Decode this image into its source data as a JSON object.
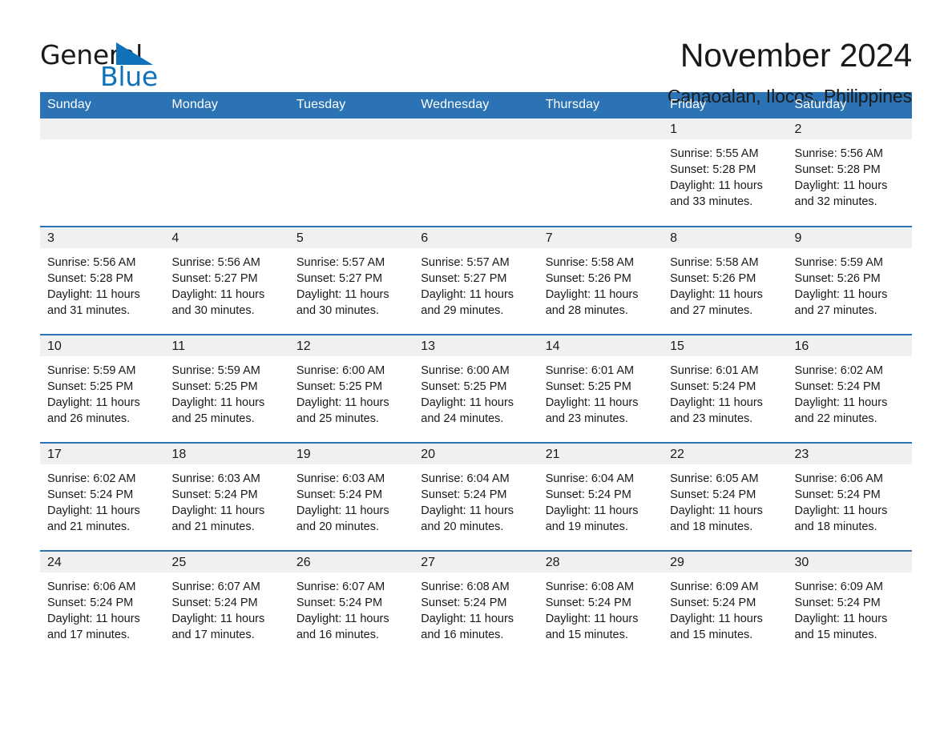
{
  "brand": {
    "name_part1": "General",
    "name_part2": "Blue",
    "triangle_icon": "triangle-icon",
    "accent_color": "#1172bc"
  },
  "header": {
    "month_title": "November 2024",
    "location": "Canaoalan, Ilocos, Philippines",
    "header_bg_color": "#2b73b5",
    "daynum_band_color": "#f0f0f0"
  },
  "weekday_headers": [
    "Sunday",
    "Monday",
    "Tuesday",
    "Wednesday",
    "Thursday",
    "Friday",
    "Saturday"
  ],
  "labels": {
    "sunrise_prefix": "Sunrise:",
    "sunset_prefix": "Sunset:",
    "daylight_prefix": "Daylight:"
  },
  "weeks": [
    [
      {
        "day": "",
        "empty": true
      },
      {
        "day": "",
        "empty": true
      },
      {
        "day": "",
        "empty": true
      },
      {
        "day": "",
        "empty": true
      },
      {
        "day": "",
        "empty": true
      },
      {
        "day": "1",
        "sunrise": "Sunrise: 5:55 AM",
        "sunset": "Sunset: 5:28 PM",
        "daylight_line1": "Daylight: 11 hours",
        "daylight_line2": "and 33 minutes."
      },
      {
        "day": "2",
        "sunrise": "Sunrise: 5:56 AM",
        "sunset": "Sunset: 5:28 PM",
        "daylight_line1": "Daylight: 11 hours",
        "daylight_line2": "and 32 minutes."
      }
    ],
    [
      {
        "day": "3",
        "sunrise": "Sunrise: 5:56 AM",
        "sunset": "Sunset: 5:28 PM",
        "daylight_line1": "Daylight: 11 hours",
        "daylight_line2": "and 31 minutes."
      },
      {
        "day": "4",
        "sunrise": "Sunrise: 5:56 AM",
        "sunset": "Sunset: 5:27 PM",
        "daylight_line1": "Daylight: 11 hours",
        "daylight_line2": "and 30 minutes."
      },
      {
        "day": "5",
        "sunrise": "Sunrise: 5:57 AM",
        "sunset": "Sunset: 5:27 PM",
        "daylight_line1": "Daylight: 11 hours",
        "daylight_line2": "and 30 minutes."
      },
      {
        "day": "6",
        "sunrise": "Sunrise: 5:57 AM",
        "sunset": "Sunset: 5:27 PM",
        "daylight_line1": "Daylight: 11 hours",
        "daylight_line2": "and 29 minutes."
      },
      {
        "day": "7",
        "sunrise": "Sunrise: 5:58 AM",
        "sunset": "Sunset: 5:26 PM",
        "daylight_line1": "Daylight: 11 hours",
        "daylight_line2": "and 28 minutes."
      },
      {
        "day": "8",
        "sunrise": "Sunrise: 5:58 AM",
        "sunset": "Sunset: 5:26 PM",
        "daylight_line1": "Daylight: 11 hours",
        "daylight_line2": "and 27 minutes."
      },
      {
        "day": "9",
        "sunrise": "Sunrise: 5:59 AM",
        "sunset": "Sunset: 5:26 PM",
        "daylight_line1": "Daylight: 11 hours",
        "daylight_line2": "and 27 minutes."
      }
    ],
    [
      {
        "day": "10",
        "sunrise": "Sunrise: 5:59 AM",
        "sunset": "Sunset: 5:25 PM",
        "daylight_line1": "Daylight: 11 hours",
        "daylight_line2": "and 26 minutes."
      },
      {
        "day": "11",
        "sunrise": "Sunrise: 5:59 AM",
        "sunset": "Sunset: 5:25 PM",
        "daylight_line1": "Daylight: 11 hours",
        "daylight_line2": "and 25 minutes."
      },
      {
        "day": "12",
        "sunrise": "Sunrise: 6:00 AM",
        "sunset": "Sunset: 5:25 PM",
        "daylight_line1": "Daylight: 11 hours",
        "daylight_line2": "and 25 minutes."
      },
      {
        "day": "13",
        "sunrise": "Sunrise: 6:00 AM",
        "sunset": "Sunset: 5:25 PM",
        "daylight_line1": "Daylight: 11 hours",
        "daylight_line2": "and 24 minutes."
      },
      {
        "day": "14",
        "sunrise": "Sunrise: 6:01 AM",
        "sunset": "Sunset: 5:25 PM",
        "daylight_line1": "Daylight: 11 hours",
        "daylight_line2": "and 23 minutes."
      },
      {
        "day": "15",
        "sunrise": "Sunrise: 6:01 AM",
        "sunset": "Sunset: 5:24 PM",
        "daylight_line1": "Daylight: 11 hours",
        "daylight_line2": "and 23 minutes."
      },
      {
        "day": "16",
        "sunrise": "Sunrise: 6:02 AM",
        "sunset": "Sunset: 5:24 PM",
        "daylight_line1": "Daylight: 11 hours",
        "daylight_line2": "and 22 minutes."
      }
    ],
    [
      {
        "day": "17",
        "sunrise": "Sunrise: 6:02 AM",
        "sunset": "Sunset: 5:24 PM",
        "daylight_line1": "Daylight: 11 hours",
        "daylight_line2": "and 21 minutes."
      },
      {
        "day": "18",
        "sunrise": "Sunrise: 6:03 AM",
        "sunset": "Sunset: 5:24 PM",
        "daylight_line1": "Daylight: 11 hours",
        "daylight_line2": "and 21 minutes."
      },
      {
        "day": "19",
        "sunrise": "Sunrise: 6:03 AM",
        "sunset": "Sunset: 5:24 PM",
        "daylight_line1": "Daylight: 11 hours",
        "daylight_line2": "and 20 minutes."
      },
      {
        "day": "20",
        "sunrise": "Sunrise: 6:04 AM",
        "sunset": "Sunset: 5:24 PM",
        "daylight_line1": "Daylight: 11 hours",
        "daylight_line2": "and 20 minutes."
      },
      {
        "day": "21",
        "sunrise": "Sunrise: 6:04 AM",
        "sunset": "Sunset: 5:24 PM",
        "daylight_line1": "Daylight: 11 hours",
        "daylight_line2": "and 19 minutes."
      },
      {
        "day": "22",
        "sunrise": "Sunrise: 6:05 AM",
        "sunset": "Sunset: 5:24 PM",
        "daylight_line1": "Daylight: 11 hours",
        "daylight_line2": "and 18 minutes."
      },
      {
        "day": "23",
        "sunrise": "Sunrise: 6:06 AM",
        "sunset": "Sunset: 5:24 PM",
        "daylight_line1": "Daylight: 11 hours",
        "daylight_line2": "and 18 minutes."
      }
    ],
    [
      {
        "day": "24",
        "sunrise": "Sunrise: 6:06 AM",
        "sunset": "Sunset: 5:24 PM",
        "daylight_line1": "Daylight: 11 hours",
        "daylight_line2": "and 17 minutes."
      },
      {
        "day": "25",
        "sunrise": "Sunrise: 6:07 AM",
        "sunset": "Sunset: 5:24 PM",
        "daylight_line1": "Daylight: 11 hours",
        "daylight_line2": "and 17 minutes."
      },
      {
        "day": "26",
        "sunrise": "Sunrise: 6:07 AM",
        "sunset": "Sunset: 5:24 PM",
        "daylight_line1": "Daylight: 11 hours",
        "daylight_line2": "and 16 minutes."
      },
      {
        "day": "27",
        "sunrise": "Sunrise: 6:08 AM",
        "sunset": "Sunset: 5:24 PM",
        "daylight_line1": "Daylight: 11 hours",
        "daylight_line2": "and 16 minutes."
      },
      {
        "day": "28",
        "sunrise": "Sunrise: 6:08 AM",
        "sunset": "Sunset: 5:24 PM",
        "daylight_line1": "Daylight: 11 hours",
        "daylight_line2": "and 15 minutes."
      },
      {
        "day": "29",
        "sunrise": "Sunrise: 6:09 AM",
        "sunset": "Sunset: 5:24 PM",
        "daylight_line1": "Daylight: 11 hours",
        "daylight_line2": "and 15 minutes."
      },
      {
        "day": "30",
        "sunrise": "Sunrise: 6:09 AM",
        "sunset": "Sunset: 5:24 PM",
        "daylight_line1": "Daylight: 11 hours",
        "daylight_line2": "and 15 minutes."
      }
    ]
  ]
}
